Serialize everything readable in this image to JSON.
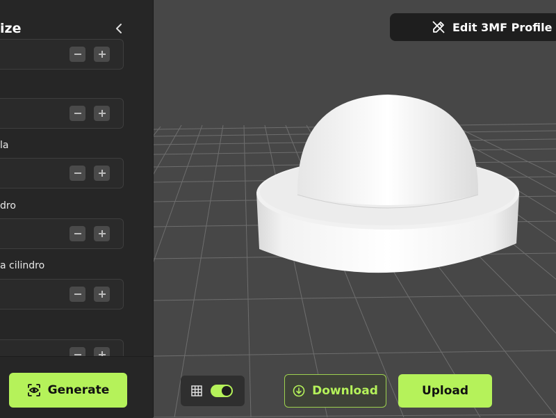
{
  "panel": {
    "title": "ize",
    "fields": [
      {
        "label": "",
        "value": ""
      },
      {
        "label": "",
        "value": ""
      },
      {
        "label": "la",
        "value": ""
      },
      {
        "label": "dro",
        "value": ""
      },
      {
        "label": "a cilindro",
        "value": ""
      },
      {
        "label": "",
        "value": ""
      }
    ],
    "generate_label": "Generate"
  },
  "toolbar": {
    "edit_profile_label": "Edit 3MF Profile",
    "download_label": "Download",
    "upload_label": "Upload",
    "grid_toggle_on": true
  },
  "icons": {
    "collapse": "chevron-left-icon",
    "edit": "edit-profile-icon",
    "generate": "eye-scan-icon",
    "grid": "grid-icon",
    "download": "download-circle-icon"
  },
  "colors": {
    "accent": "#b5f25a",
    "panel_bg": "#262626",
    "viewport_bg": "#474747",
    "model": "#f4f4f4"
  }
}
